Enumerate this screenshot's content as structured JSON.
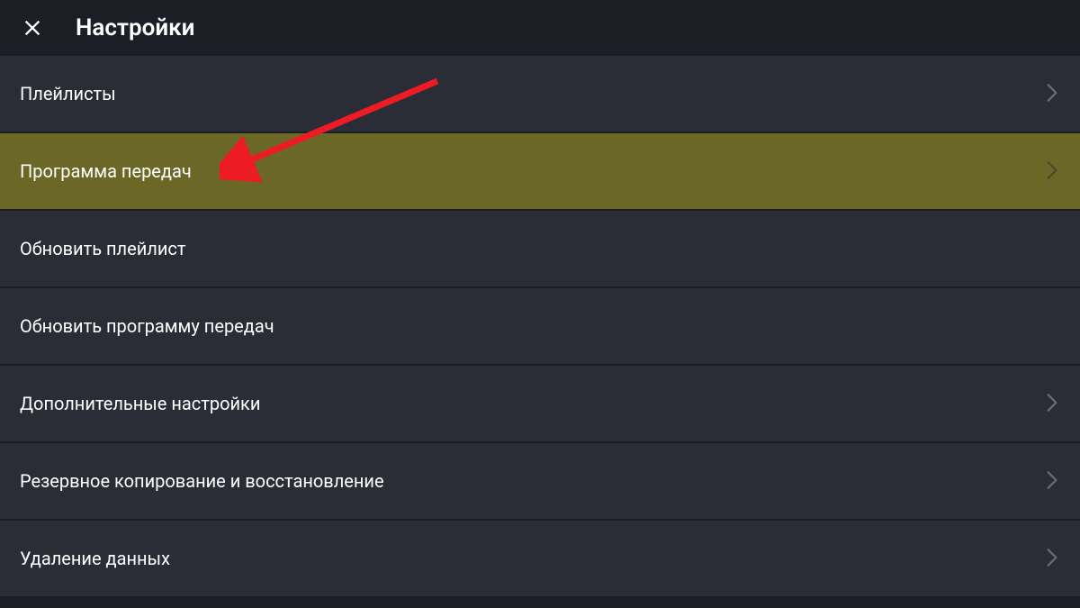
{
  "header": {
    "title": "Настройки"
  },
  "menu": {
    "items": [
      {
        "label": "Плейлисты",
        "highlighted": false,
        "showChevron": true
      },
      {
        "label": "Программа передач",
        "highlighted": true,
        "showChevron": true
      },
      {
        "label": "Обновить плейлист",
        "highlighted": false,
        "showChevron": false
      },
      {
        "label": "Обновить программу передач",
        "highlighted": false,
        "showChevron": false
      },
      {
        "label": "Дополнительные настройки",
        "highlighted": false,
        "showChevron": true
      },
      {
        "label": "Резервное копирование и восстановление",
        "highlighted": false,
        "showChevron": true
      },
      {
        "label": "Удаление данных",
        "highlighted": false,
        "showChevron": true
      }
    ]
  },
  "annotation": {
    "arrow_color": "#ed1c24"
  }
}
